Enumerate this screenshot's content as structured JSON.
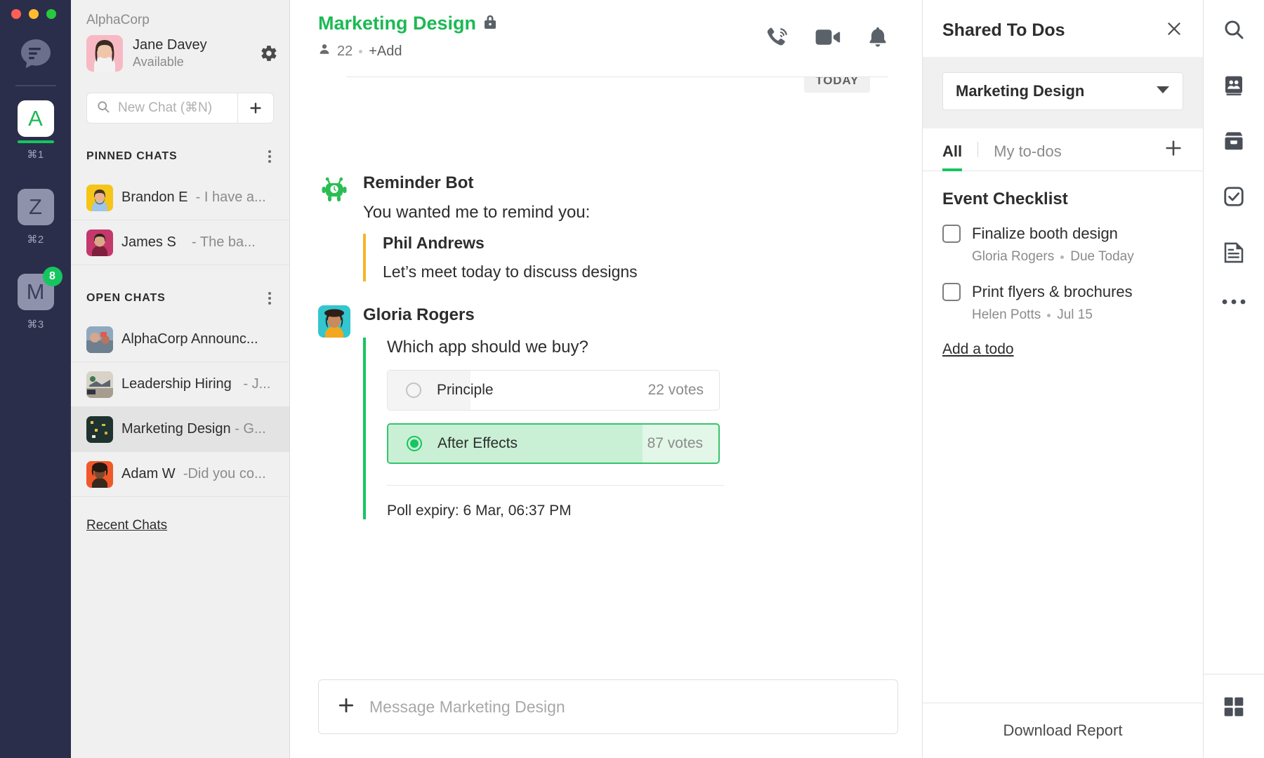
{
  "window": {
    "traffic_lights": [
      "close",
      "minimize",
      "maximize"
    ]
  },
  "rail": {
    "logo": "flock-logo-icon",
    "workspaces": [
      {
        "letter": "A",
        "shortcut": "⌘1",
        "active": true,
        "badge": null
      },
      {
        "letter": "Z",
        "shortcut": "⌘2",
        "active": false,
        "badge": null
      },
      {
        "letter": "M",
        "shortcut": "⌘3",
        "active": false,
        "badge": "8"
      }
    ]
  },
  "sidebar": {
    "org": "AlphaCorp",
    "user": {
      "name": "Jane Davey",
      "status": "Available"
    },
    "settings_icon": "gear-icon",
    "search": {
      "placeholder": "New Chat (⌘N)",
      "value": ""
    },
    "new_chat_label": "+",
    "sections": [
      {
        "title": "PINNED CHATS",
        "items": [
          {
            "name": "Brandon E",
            "preview": "- I have a...",
            "selected": false
          },
          {
            "name": "James S",
            "preview": "- The ba...",
            "selected": false
          }
        ]
      },
      {
        "title": "OPEN CHATS",
        "items": [
          {
            "name": "AlphaCorp Announc...",
            "preview": "",
            "selected": false
          },
          {
            "name": "Leadership Hiring",
            "preview": "- J...",
            "selected": false
          },
          {
            "name": "Marketing Design",
            "preview": "- G...",
            "selected": true
          },
          {
            "name": "Adam W",
            "preview": "-Did you co...",
            "selected": false
          }
        ]
      }
    ],
    "recent_chats": "Recent Chats"
  },
  "chat": {
    "room_name": "Marketing Design",
    "lock_icon": "lock-icon",
    "member_count": "22",
    "add_label": "+Add",
    "header_icons": [
      "phone-call-icon",
      "video-camera-icon",
      "bell-icon"
    ],
    "date_divider": "TODAY",
    "messages": [
      {
        "sender": "Reminder Bot",
        "avatar": "reminder-bot-avatar",
        "line": "You wanted me to remind you:",
        "quote": {
          "name": "Phil Andrews",
          "text": "Let’s meet today to discuss designs"
        }
      },
      {
        "sender": "Gloria Rogers",
        "avatar": "gloria-rogers-avatar",
        "poll": {
          "question": "Which app should we buy?",
          "options": [
            {
              "label": "Principle",
              "votes": "22 votes",
              "selected": false,
              "percent": 25
            },
            {
              "label": "After Effects",
              "votes": "87 votes",
              "selected": true,
              "percent": 77
            }
          ],
          "expiry": "Poll expiry: 6 Mar, 06:37 PM"
        }
      }
    ],
    "composer": {
      "placeholder": "Message Marketing Design",
      "value": "",
      "attach_icon": "plus-icon"
    }
  },
  "todos": {
    "title": "Shared To Dos",
    "close_icon": "close-icon",
    "picker": {
      "value": "Marketing Design",
      "icon": "chevron-down-icon"
    },
    "tabs": [
      {
        "label": "All",
        "active": true
      },
      {
        "label": "My to-dos",
        "active": false
      }
    ],
    "add_icon": "plus-icon",
    "group_title": "Event Checklist",
    "items": [
      {
        "title": "Finalize booth design",
        "assignee": "Gloria Rogers",
        "due": "Due Today",
        "checked": false
      },
      {
        "title": "Print flyers & brochures",
        "assignee": "Helen Potts",
        "due": "Jul 15",
        "checked": false
      }
    ],
    "add_todo_label": "Add a todo",
    "download_label": "Download Report"
  },
  "right_rail": {
    "items": [
      "search-icon",
      "contacts-icon",
      "archive-icon",
      "todo-check-icon",
      "notes-icon",
      "more-options-icon"
    ],
    "bottom": "apps-grid-icon"
  },
  "colors": {
    "accent_green": "#16c55f",
    "rail_bg": "#2b2e4a",
    "sidebar_bg": "#f0f0f0",
    "quote_yellow": "#f5b52a"
  }
}
